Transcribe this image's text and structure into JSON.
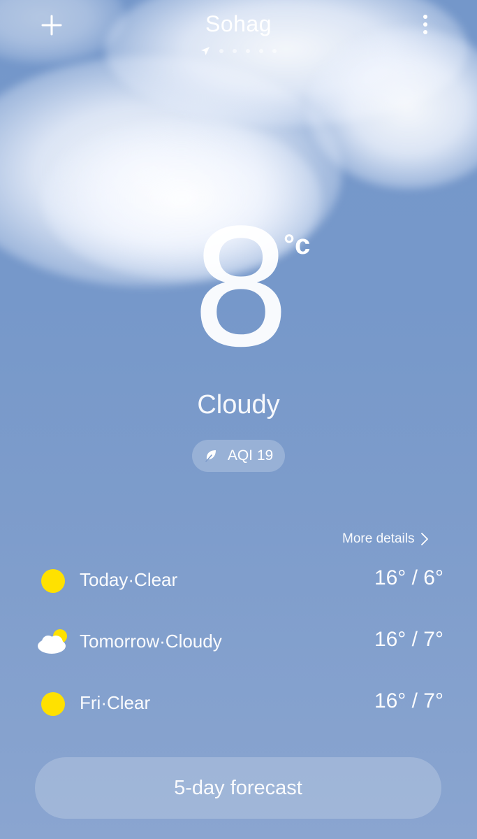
{
  "header": {
    "city": "Sohag",
    "add_icon": "plus-icon",
    "menu_icon": "more-vert-icon",
    "location_icon": "navigation-arrow-icon",
    "page_count": 5
  },
  "current": {
    "temperature": "8",
    "unit": "°c",
    "condition": "Cloudy",
    "aqi_label": "AQI 19",
    "aqi_icon": "leaf-icon"
  },
  "details": {
    "more_label": "More details",
    "more_icon": "chevron-right-icon"
  },
  "forecast": [
    {
      "label": "Today·Clear",
      "temps": "16° / 6°",
      "icon": "sun-icon"
    },
    {
      "label": "Tomorrow·Cloudy",
      "temps": "16° / 7°",
      "icon": "partly-cloudy-icon"
    },
    {
      "label": "Fri·Clear",
      "temps": "16° / 7°",
      "icon": "sun-icon"
    }
  ],
  "footer": {
    "button_label": "5-day forecast"
  },
  "colors": {
    "background": "#7698ca",
    "sun": "#ffe100",
    "text": "#ffffff"
  }
}
